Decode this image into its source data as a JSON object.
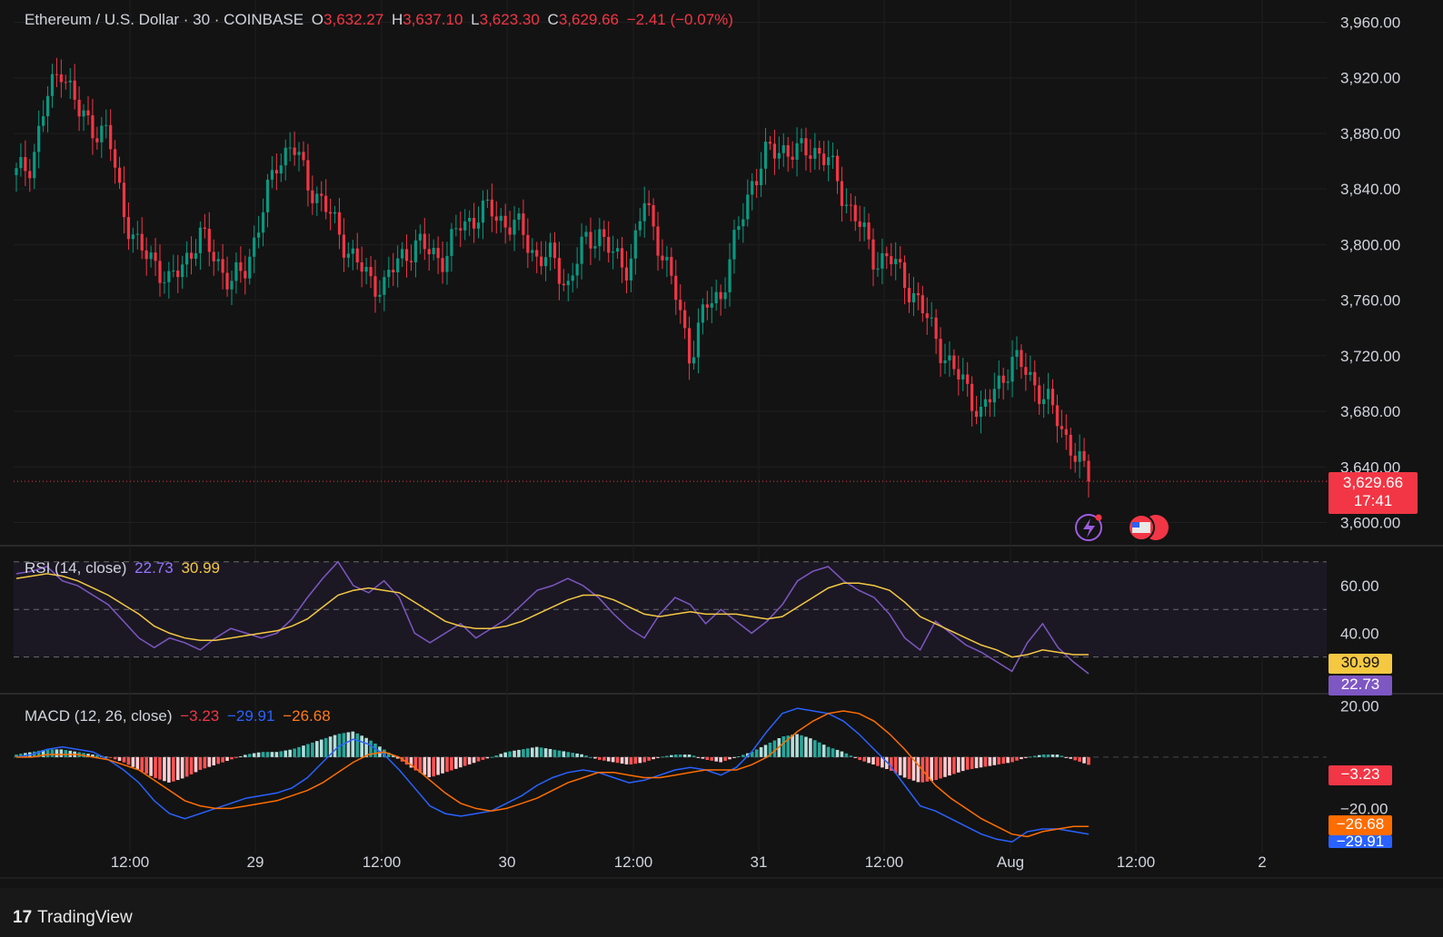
{
  "header": {
    "symbol": "Ethereum / U.S. Dollar · 30 · COINBASE",
    "o_label": "O",
    "o_value": "3,632.27",
    "h_label": "H",
    "h_value": "3,637.10",
    "l_label": "L",
    "l_value": "3,623.30",
    "c_label": "C",
    "c_value": "3,629.66",
    "change": "−2.41 (−0.07%)"
  },
  "rsi_legend": {
    "name": "RSI (14, close)",
    "rsi": "22.73",
    "ma": "30.99"
  },
  "macd_legend": {
    "name": "MACD (12, 26, close)",
    "hist": "−3.23",
    "macd": "−29.91",
    "signal": "−26.68"
  },
  "price_badge": {
    "value": "3,629.66",
    "countdown": "17:41"
  },
  "rsi_badges": {
    "ma": "30.99",
    "rsi": "22.73"
  },
  "macd_badges": {
    "hist": "−3.23",
    "signal": "−26.68",
    "macd": "−29.91"
  },
  "brand": "TradingView",
  "colors": {
    "up": "#089981",
    "down": "#f23645",
    "rsi": "#7e57c2",
    "rsi_ma": "#f5c842",
    "macd": "#2962ff",
    "signal": "#ff6d00"
  },
  "chart_data": [
    {
      "type": "candlestick",
      "title": "Ethereum / U.S. Dollar · 30 · COINBASE",
      "ylim": [
        3584,
        3976
      ],
      "y_ticks": [
        "3,960.00",
        "3,920.00",
        "3,880.00",
        "3,840.00",
        "3,800.00",
        "3,760.00",
        "3,720.00",
        "3,680.00",
        "3,640.00",
        "3,600.00"
      ],
      "x_ticks": [
        "12:00",
        "29",
        "12:00",
        "30",
        "12:00",
        "31",
        "12:00",
        "Aug",
        "12:00",
        "2"
      ],
      "last_price": 3629.66,
      "close_path": [
        3850,
        3860,
        3905,
        3930,
        3895,
        3885,
        3878,
        3825,
        3795,
        3790,
        3770,
        3790,
        3805,
        3792,
        3770,
        3785,
        3820,
        3860,
        3872,
        3845,
        3830,
        3810,
        3790,
        3775,
        3770,
        3790,
        3800,
        3795,
        3790,
        3815,
        3820,
        3825,
        3815,
        3810,
        3790,
        3790,
        3770,
        3800,
        3810,
        3790,
        3785,
        3830,
        3800,
        3765,
        3720,
        3755,
        3765,
        3805,
        3845,
        3865,
        3870,
        3865,
        3870,
        3860,
        3835,
        3815,
        3790,
        3790,
        3775,
        3755,
        3735,
        3710,
        3700,
        3675,
        3700,
        3715,
        3710,
        3690,
        3675,
        3650,
        3630
      ]
    },
    {
      "type": "line",
      "title": "RSI (14, close)",
      "y_ticks": [
        "60.00",
        "40.00"
      ],
      "bands": [
        70,
        50,
        30
      ],
      "ylim": [
        15,
        76
      ],
      "series": [
        {
          "name": "RSI",
          "values": [
            65,
            66,
            68,
            62,
            60,
            56,
            52,
            45,
            38,
            34,
            38,
            36,
            33,
            38,
            42,
            40,
            38,
            40,
            46,
            55,
            63,
            70,
            60,
            57,
            62,
            55,
            40,
            36,
            40,
            44,
            38,
            42,
            46,
            52,
            58,
            60,
            63,
            60,
            55,
            48,
            42,
            38,
            48,
            55,
            52,
            44,
            50,
            45,
            40,
            45,
            52,
            62,
            66,
            68,
            62,
            58,
            55,
            48,
            38,
            33,
            45,
            40,
            35,
            32,
            28,
            24,
            36,
            44,
            34,
            28,
            23
          ]
        },
        {
          "name": "MA",
          "values": [
            63,
            64,
            65,
            64,
            62,
            59,
            56,
            52,
            48,
            43,
            40,
            38,
            37,
            37,
            38,
            39,
            40,
            41,
            43,
            46,
            51,
            56,
            58,
            59,
            58,
            57,
            53,
            49,
            45,
            43,
            42,
            42,
            43,
            45,
            48,
            51,
            54,
            56,
            56,
            54,
            51,
            48,
            47,
            48,
            49,
            48,
            48,
            48,
            47,
            46,
            47,
            51,
            55,
            59,
            61,
            61,
            60,
            58,
            53,
            47,
            44,
            41,
            38,
            35,
            33,
            30,
            31,
            33,
            32,
            31,
            31
          ]
        }
      ]
    },
    {
      "type": "bar",
      "title": "MACD (12, 26, close)",
      "y_ticks": [
        "20.00",
        "−20.00"
      ],
      "ylim": [
        -34,
        24
      ],
      "series": [
        {
          "name": "Histogram",
          "values": [
            1,
            2,
            3,
            3,
            2,
            1,
            0,
            -2,
            -5,
            -8,
            -10,
            -8,
            -5,
            -3,
            -1,
            1,
            2,
            2,
            3,
            5,
            7,
            9,
            10,
            7,
            3,
            -1,
            -5,
            -8,
            -6,
            -4,
            -2,
            0,
            2,
            3,
            4,
            3,
            2,
            1,
            -1,
            -2,
            -3,
            -2,
            0,
            1,
            1,
            -1,
            -2,
            0,
            2,
            5,
            8,
            9,
            7,
            4,
            2,
            -1,
            -3,
            -5,
            -8,
            -10,
            -9,
            -7,
            -5,
            -4,
            -3,
            -2,
            0,
            1,
            1,
            -1,
            -3
          ]
        },
        {
          "name": "MACD",
          "values": [
            0,
            1,
            3,
            4,
            3,
            2,
            -1,
            -5,
            -10,
            -17,
            -22,
            -24,
            -22,
            -20,
            -18,
            -16,
            -15,
            -14,
            -12,
            -8,
            -2,
            4,
            7,
            5,
            1,
            -5,
            -12,
            -19,
            -22,
            -23,
            -22,
            -21,
            -18,
            -15,
            -11,
            -8,
            -6,
            -5,
            -6,
            -8,
            -10,
            -9,
            -7,
            -5,
            -4,
            -5,
            -7,
            -4,
            2,
            10,
            17,
            19,
            18,
            17,
            14,
            9,
            3,
            -3,
            -11,
            -19,
            -21,
            -24,
            -27,
            -30,
            -32,
            -33,
            -29,
            -28,
            -28,
            -29,
            -30
          ]
        },
        {
          "name": "Signal",
          "values": [
            0,
            0,
            1,
            1,
            1,
            0,
            -1,
            -3,
            -5,
            -9,
            -13,
            -17,
            -19,
            -20,
            -20,
            -19,
            -18,
            -17,
            -15,
            -13,
            -10,
            -6,
            -2,
            1,
            2,
            0,
            -4,
            -9,
            -14,
            -18,
            -20,
            -21,
            -20,
            -18,
            -16,
            -13,
            -10,
            -8,
            -6,
            -6,
            -7,
            -8,
            -8,
            -7,
            -6,
            -5,
            -5,
            -5,
            -3,
            0,
            5,
            10,
            14,
            17,
            18,
            17,
            14,
            9,
            3,
            -4,
            -11,
            -16,
            -20,
            -24,
            -27,
            -30,
            -31,
            -29,
            -28,
            -27,
            -27
          ]
        }
      ]
    }
  ]
}
